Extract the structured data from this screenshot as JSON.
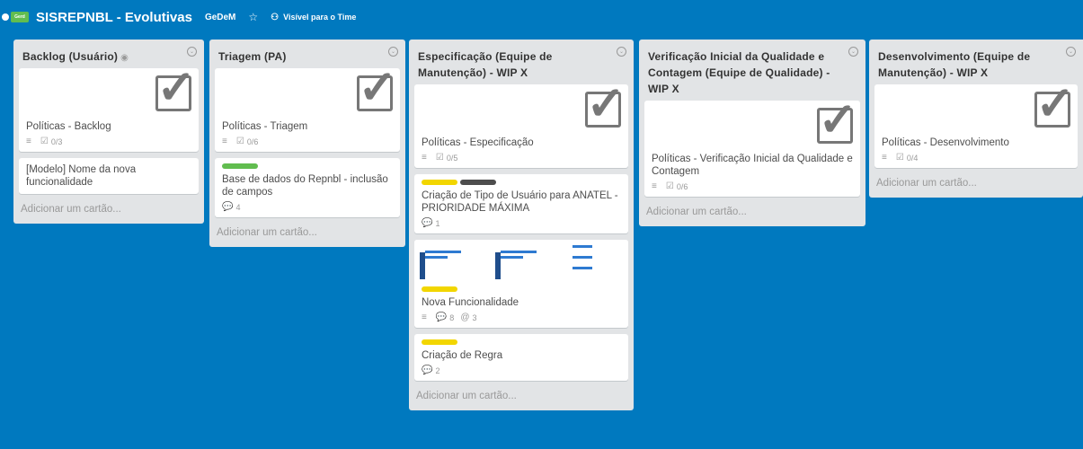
{
  "header": {
    "logo_text": "Gerd",
    "title": "SISREPNBL - Evolutivas",
    "team": "GeDeM",
    "visibility": "Visível para o Time"
  },
  "add_card_label": "Adicionar um cartão...",
  "lists": [
    {
      "title": "Backlog (Usuário)",
      "cards": [
        {
          "title": "Políticas - Backlog",
          "checklist": "0/3"
        },
        {
          "title": "[Modelo] Nome da nova funcionalidade"
        }
      ]
    },
    {
      "title": "Triagem (PA)",
      "cards": [
        {
          "title": "Políticas - Triagem",
          "checklist": "0/6"
        },
        {
          "title": "Base de dados do Repnbl - inclusão de campos",
          "comments": "4"
        }
      ]
    },
    {
      "title": "Especificação (Equipe de Manutenção) - WIP X",
      "cards": [
        {
          "title": "Políticas - Especificação",
          "checklist": "0/5"
        },
        {
          "title": "Criação de Tipo de Usuário para ANATEL - PRIORIDADE MÁXIMA",
          "comments": "1"
        },
        {
          "title": "Nova Funcionalidade",
          "comments": "8",
          "attachments": "3"
        },
        {
          "title": "Criação de Regra",
          "comments": "2"
        }
      ]
    },
    {
      "title": "Verificação Inicial da Qualidade e Contagem (Equipe de Qualidade) - WIP X",
      "cards": [
        {
          "title": "Políticas - Verificação Inicial da Qualidade e Contagem",
          "checklist": "0/6"
        }
      ]
    },
    {
      "title": "Desenvolvimento (Equipe de Manutenção) - WIP X",
      "cards": [
        {
          "title": "Políticas - Desenvolvimento",
          "checklist": "0/4"
        }
      ]
    }
  ],
  "colors": {
    "board_bg": "#0079bf",
    "label_green": "#61bd4f",
    "label_yellow": "#f2d600",
    "label_black": "#4d4d4d"
  }
}
